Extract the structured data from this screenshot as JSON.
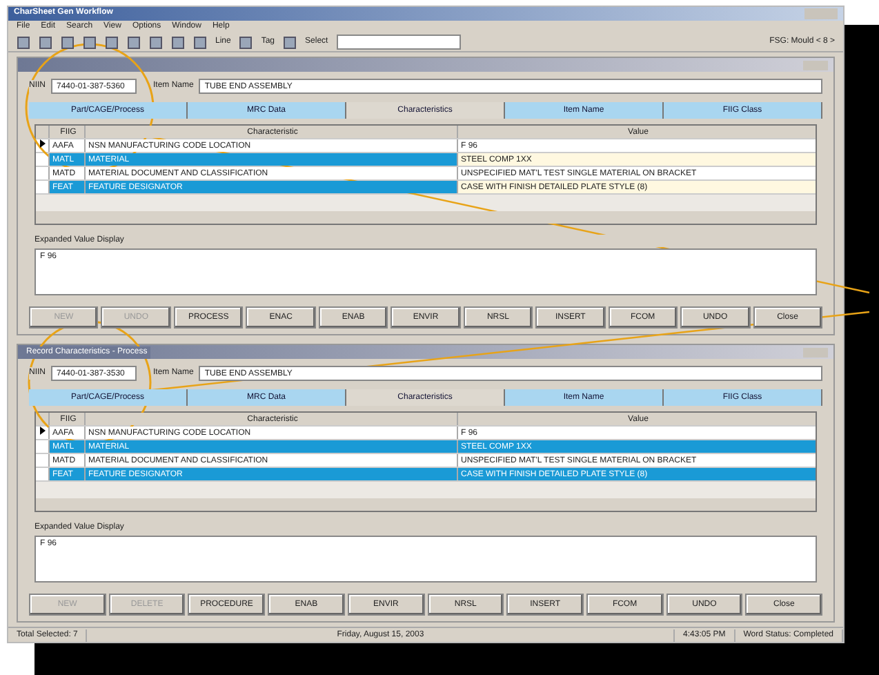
{
  "window": {
    "title": "CharSheet Gen Workflow"
  },
  "menu": [
    "File",
    "Edit",
    "Search",
    "View",
    "Options",
    "Window",
    "Help"
  ],
  "toolbar": {
    "items": [
      "Line",
      "Tag",
      "Select"
    ],
    "status": "FSG: Mould < 8 >"
  },
  "panels": [
    {
      "niin_label": "NIIN",
      "niin": "7440-01-387-5360",
      "item_name_label": "Item Name",
      "item_name": "TUBE END ASSEMBLY",
      "tabs": [
        {
          "label": "Part/CAGE/Process",
          "selected": false
        },
        {
          "label": "MRC Data",
          "selected": false
        },
        {
          "label": "Characteristics",
          "selected": true
        },
        {
          "label": "Item Name",
          "selected": false
        },
        {
          "label": "FIIG Class",
          "selected": false
        }
      ],
      "columns": [
        "FIIG",
        "Characteristic",
        "Value"
      ],
      "rows": [
        {
          "fiig": "AAFA",
          "characteristic": "NSN MANUFACTURING CODE LOCATION",
          "value": "F 96",
          "current": true,
          "selected": false
        },
        {
          "fiig": "MATL",
          "characteristic": "MATERIAL",
          "value": "STEEL COMP 1XX",
          "current": false,
          "selected": true
        },
        {
          "fiig": "MATD",
          "characteristic": "MATERIAL DOCUMENT AND CLASSIFICATION",
          "value": "UNSPECIFIED MAT'L TEST SINGLE MATERIAL ON BRACKET",
          "current": false,
          "selected": false
        },
        {
          "fiig": "FEAT",
          "characteristic": "FEATURE DESIGNATOR",
          "value": "CASE WITH FINISH DETAILED PLATE STYLE (8)",
          "current": false,
          "selected": true
        }
      ],
      "expanded_label": "Expanded Value Display",
      "expanded_value": "F 96",
      "buttons": [
        {
          "label": "NEW",
          "disabled": true
        },
        {
          "label": "UNDO",
          "disabled": true
        },
        {
          "label": "PROCESS",
          "disabled": false
        },
        {
          "label": "ENAC",
          "disabled": false
        },
        {
          "label": "ENAB",
          "disabled": false
        },
        {
          "label": "ENVIR",
          "disabled": false
        },
        {
          "label": "NRSL",
          "disabled": false
        },
        {
          "label": "INSERT",
          "disabled": false
        },
        {
          "label": "FCOM",
          "disabled": false
        },
        {
          "label": "UNDO",
          "disabled": false
        },
        {
          "label": "Close",
          "disabled": false
        }
      ]
    },
    {
      "title": "Record Characteristics - Process",
      "niin_label": "NIIN",
      "niin": "7440-01-387-3530",
      "item_name_label": "Item Name",
      "item_name": "TUBE END ASSEMBLY",
      "tabs": [
        {
          "label": "Part/CAGE/Process",
          "selected": false
        },
        {
          "label": "MRC Data",
          "selected": false
        },
        {
          "label": "Characteristics",
          "selected": true
        },
        {
          "label": "Item Name",
          "selected": false
        },
        {
          "label": "FIIG Class",
          "selected": false
        }
      ],
      "columns": [
        "FIIG",
        "Characteristic",
        "Value"
      ],
      "rows": [
        {
          "fiig": "AAFA",
          "characteristic": "NSN MANUFACTURING CODE LOCATION",
          "value": "F 96",
          "current": true,
          "selected": false
        },
        {
          "fiig": "MATL",
          "characteristic": "MATERIAL",
          "value": "STEEL COMP 1XX",
          "current": false,
          "selected": true
        },
        {
          "fiig": "MATD",
          "characteristic": "MATERIAL DOCUMENT AND CLASSIFICATION",
          "value": "UNSPECIFIED MAT'L TEST SINGLE MATERIAL ON BRACKET",
          "current": false,
          "selected": false
        },
        {
          "fiig": "FEAT",
          "characteristic": "FEATURE DESIGNATOR",
          "value": "CASE WITH FINISH DETAILED PLATE STYLE (8)",
          "current": false,
          "selected": true
        }
      ],
      "expanded_label": "Expanded Value Display",
      "expanded_value": "F 96",
      "buttons": [
        {
          "label": "NEW",
          "disabled": true
        },
        {
          "label": "DELETE",
          "disabled": true
        },
        {
          "label": "PROCEDURE",
          "disabled": false
        },
        {
          "label": "ENAB",
          "disabled": false
        },
        {
          "label": "ENVIR",
          "disabled": false
        },
        {
          "label": "NRSL",
          "disabled": false
        },
        {
          "label": "INSERT",
          "disabled": false
        },
        {
          "label": "FCOM",
          "disabled": false
        },
        {
          "label": "UNDO",
          "disabled": false
        },
        {
          "label": "Close",
          "disabled": false
        }
      ]
    }
  ],
  "status_bar": [
    "Total Selected: 7",
    "Friday, August 15, 2003",
    "4:43:05 PM",
    "Word Status: Completed"
  ]
}
